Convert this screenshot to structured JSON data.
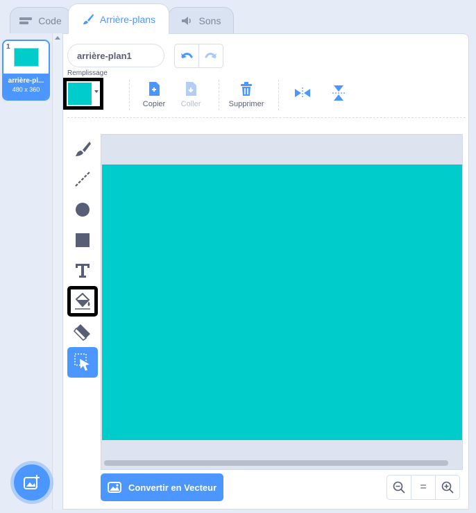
{
  "tabs": [
    {
      "label": "Code",
      "icon": "code-icon"
    },
    {
      "label": "Arrière-plans",
      "icon": "brush-icon"
    },
    {
      "label": "Sons",
      "icon": "speaker-icon"
    }
  ],
  "active_tab": "Arrière-plans",
  "backdrops": [
    {
      "number": "1",
      "name": "arrière-pl...",
      "size": "480 x 360",
      "color": "#00cccc"
    }
  ],
  "editor": {
    "name_value": "arrière-plan1",
    "fill_label": "Remplissage",
    "fill_color": "#00cccc",
    "actions": {
      "copy": "Copier",
      "paste": "Coller",
      "delete": "Supprimer"
    },
    "convert_button": "Convertir en Vecteur",
    "zoom": {
      "out": "−",
      "reset": "=",
      "in": "+"
    }
  },
  "tools": [
    {
      "name": "brush-tool",
      "icon": "brush-icon"
    },
    {
      "name": "line-tool",
      "icon": "line-icon"
    },
    {
      "name": "circle-tool",
      "icon": "circle-icon"
    },
    {
      "name": "rectangle-tool",
      "icon": "rectangle-icon"
    },
    {
      "name": "text-tool",
      "icon": "text-icon"
    },
    {
      "name": "fill-tool",
      "icon": "paint-bucket-icon"
    },
    {
      "name": "eraser-tool",
      "icon": "eraser-icon"
    },
    {
      "name": "select-tool",
      "icon": "select-icon"
    }
  ],
  "selected_tool": "select-tool",
  "colors": {
    "accent": "#4c97ff",
    "canvas_fill": "#00cccc",
    "panel_bg": "#e5ecf7"
  }
}
